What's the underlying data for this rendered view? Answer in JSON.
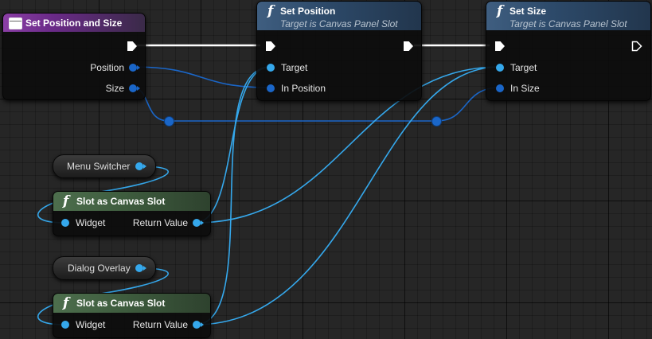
{
  "colors": {
    "wire_object": "#35a8ec",
    "wire_vector": "#1a66c8",
    "exec_wire": "#ffffff",
    "header_event": "#8b3fa6",
    "header_function": "#3f5e80",
    "header_pure": "#4d6e4d"
  },
  "nodes": {
    "set_position_and_size": {
      "title": "Set Position and Size",
      "icon": "event-icon",
      "pins": {
        "position": "Position",
        "size": "Size"
      }
    },
    "set_position": {
      "title": "Set Position",
      "subtitle": "Target is Canvas Panel Slot",
      "icon": "function-icon",
      "pins": {
        "target": "Target",
        "in_position": "In Position"
      }
    },
    "set_size": {
      "title": "Set Size",
      "subtitle": "Target is Canvas Panel Slot",
      "icon": "function-icon",
      "pins": {
        "target": "Target",
        "in_size": "In Size"
      }
    },
    "menu_switcher": {
      "label": "Menu Switcher"
    },
    "slot_cast_1": {
      "title": "Slot as Canvas Slot",
      "icon": "function-icon",
      "pins": {
        "widget": "Widget",
        "return_value": "Return Value"
      }
    },
    "dialog_overlay": {
      "label": "Dialog Overlay"
    },
    "slot_cast_2": {
      "title": "Slot as Canvas Slot",
      "icon": "function-icon",
      "pins": {
        "widget": "Widget",
        "return_value": "Return Value"
      }
    }
  },
  "function_glyph": "f"
}
